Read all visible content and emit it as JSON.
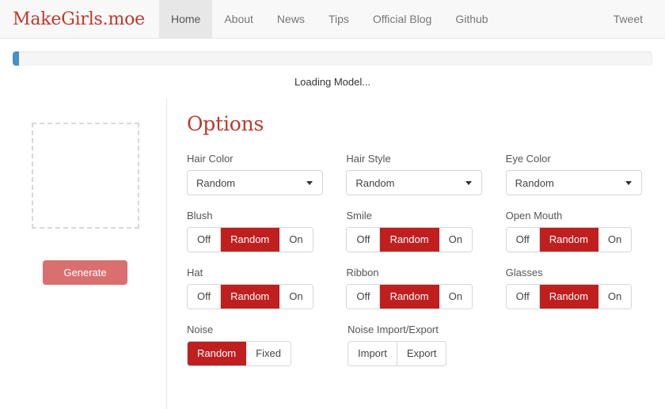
{
  "navbar": {
    "brand": "MakeGirls.moe",
    "links": [
      {
        "label": "Home",
        "active": true
      },
      {
        "label": "About",
        "active": false
      },
      {
        "label": "News",
        "active": false
      },
      {
        "label": "Tips",
        "active": false
      },
      {
        "label": "Official Blog",
        "active": false
      },
      {
        "label": "Github",
        "active": false
      }
    ],
    "tweet": "Tweet"
  },
  "progress": {
    "percent": 1,
    "status": "Loading Model...",
    "fill_color": "#4a90c4"
  },
  "left_panel": {
    "generate_label": "Generate",
    "generate_color": "#d9706f"
  },
  "options": {
    "title": "Options",
    "accent_color": "#b93c2e",
    "active_color": "#bf1f1f",
    "row1": [
      {
        "label": "Hair Color",
        "value": "Random"
      },
      {
        "label": "Hair Style",
        "value": "Random"
      },
      {
        "label": "Eye Color",
        "value": "Random"
      }
    ],
    "row2": [
      {
        "label": "Blush",
        "buttons": [
          "Off",
          "Random",
          "On"
        ],
        "active": 1
      },
      {
        "label": "Smile",
        "buttons": [
          "Off",
          "Random",
          "On"
        ],
        "active": 1
      },
      {
        "label": "Open Mouth",
        "buttons": [
          "Off",
          "Random",
          "On"
        ],
        "active": 1
      }
    ],
    "row3": [
      {
        "label": "Hat",
        "buttons": [
          "Off",
          "Random",
          "On"
        ],
        "active": 1
      },
      {
        "label": "Ribbon",
        "buttons": [
          "Off",
          "Random",
          "On"
        ],
        "active": 1
      },
      {
        "label": "Glasses",
        "buttons": [
          "Off",
          "Random",
          "On"
        ],
        "active": 1
      }
    ],
    "row4": [
      {
        "label": "Noise",
        "buttons": [
          "Random",
          "Fixed"
        ],
        "active": 0
      },
      {
        "label": "Noise Import/Export",
        "buttons": [
          "Import",
          "Export"
        ],
        "active": -1
      }
    ]
  }
}
